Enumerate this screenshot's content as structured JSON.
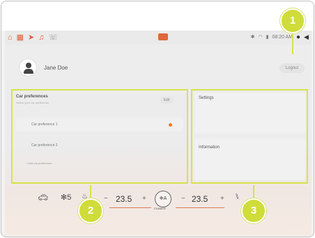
{
  "status_bar": {
    "icons": [
      "home-icon",
      "apps-icon",
      "navigation-icon",
      "music-icon",
      "phone-icon"
    ],
    "right_icons": [
      "bluetooth-icon",
      "wifi-icon",
      "signal-icon"
    ],
    "time": "08:20 AM",
    "volume_icon": "volume-icon"
  },
  "profile": {
    "name": "Jane Doe",
    "logout_label": "Logout"
  },
  "car_preferences": {
    "title": "Car preferences",
    "subtitle": "Select your car preference",
    "edit_label": "Edit",
    "items": [
      "Car preference 1",
      "Car preference 2"
    ],
    "add_label": "+ Add car preference"
  },
  "settings": {
    "title": "Settings"
  },
  "information": {
    "title": "Information"
  },
  "climate_bar": {
    "fan_speed": "5",
    "left_temp": "23.5",
    "right_temp": "23.5",
    "minus": "−",
    "plus": "+",
    "climate_label": "CLIMATE",
    "climate_icon_text": "❄A"
  },
  "callouts": [
    "1",
    "2",
    "3"
  ],
  "colors": {
    "highlight": "#d6e34a",
    "callout": "#cfdc3a",
    "accent": "#f07a2a"
  }
}
